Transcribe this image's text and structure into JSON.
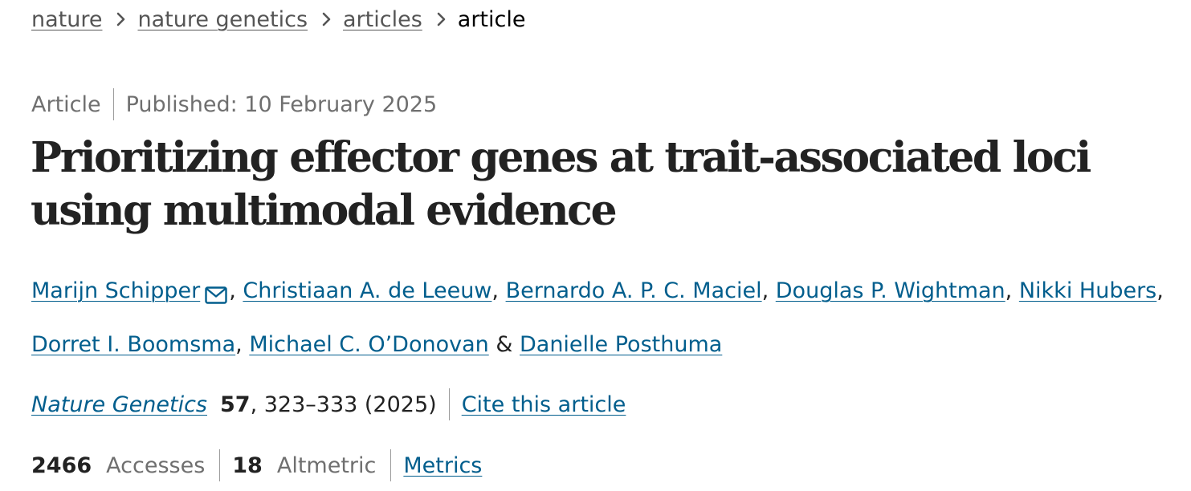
{
  "breadcrumb": {
    "items": [
      {
        "label": "nature"
      },
      {
        "label": "nature genetics"
      },
      {
        "label": "articles"
      }
    ],
    "current": "article",
    "separator_icon": "chevron-right-icon"
  },
  "article_meta": {
    "type": "Article",
    "published": "Published: 10 February 2025"
  },
  "title": "Prioritizing effector genes at trait-associated loci using multimodal evidence",
  "authors": {
    "list": [
      {
        "name": "Marijn Schipper",
        "corresponding": true
      },
      {
        "name": "Christiaan A. de Leeuw"
      },
      {
        "name": "Bernardo A. P. C. Maciel"
      },
      {
        "name": "Douglas P. Wightman"
      },
      {
        "name": "Nikki Hubers"
      },
      {
        "name": "Dorret I. Boomsma"
      },
      {
        "name": "Michael C. O’Donovan"
      },
      {
        "name": "Danielle Posthuma"
      }
    ],
    "comma": ", ",
    "ampersand": " & ",
    "mail_icon": "mail-icon"
  },
  "citation": {
    "journal": "Nature Genetics",
    "volume": "57",
    "pages_year": ", 323–333 (2025)",
    "cite_label": "Cite this article"
  },
  "metrics": {
    "accesses_count": "2466",
    "accesses_label": "Accesses",
    "altmetric_count": "18",
    "altmetric_label": "Altmetric",
    "metrics_link": "Metrics"
  },
  "colors": {
    "link": "#025e8d",
    "text": "#222222",
    "muted": "#6f6f6f",
    "divider": "#9b9b9b"
  }
}
